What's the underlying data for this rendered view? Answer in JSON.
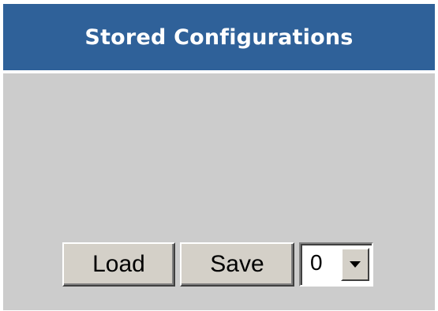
{
  "header": {
    "title": "Stored Configurations"
  },
  "controls": {
    "load_label": "Load",
    "save_label": "Save",
    "slot_select": {
      "selected_value": "0",
      "arrow_icon": "chevron-down-icon"
    }
  },
  "colors": {
    "header_background": "#2f6199",
    "header_text": "#ffffff",
    "panel_background": "#cccccc",
    "button_face": "#d4d0c8"
  }
}
